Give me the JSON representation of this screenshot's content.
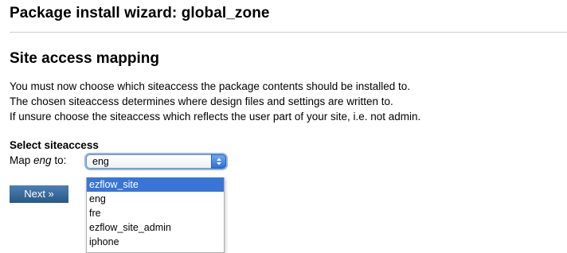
{
  "wizard": {
    "title": "Package install wizard: global_zone"
  },
  "section": {
    "title": "Site access mapping",
    "intro_lines": [
      "You must now choose which siteaccess the package contents should be installed to.",
      "The chosen siteaccess determines where design files and settings are written to.",
      "If unsure choose the siteaccess which reflects the user part of your site, i.e. not admin."
    ]
  },
  "form": {
    "select_label": "Select siteaccess",
    "map_prefix": "Map",
    "map_language": "eng",
    "map_suffix": "to:",
    "selected_value": "eng",
    "next_label": "Next »"
  },
  "dropdown": {
    "highlighted_option": "ezflow_site",
    "options": [
      "ezflow_site",
      "eng",
      "fre",
      "ezflow_site_admin",
      "iphone"
    ]
  },
  "colors": {
    "accent": "#3875d7",
    "button": "#275985"
  }
}
